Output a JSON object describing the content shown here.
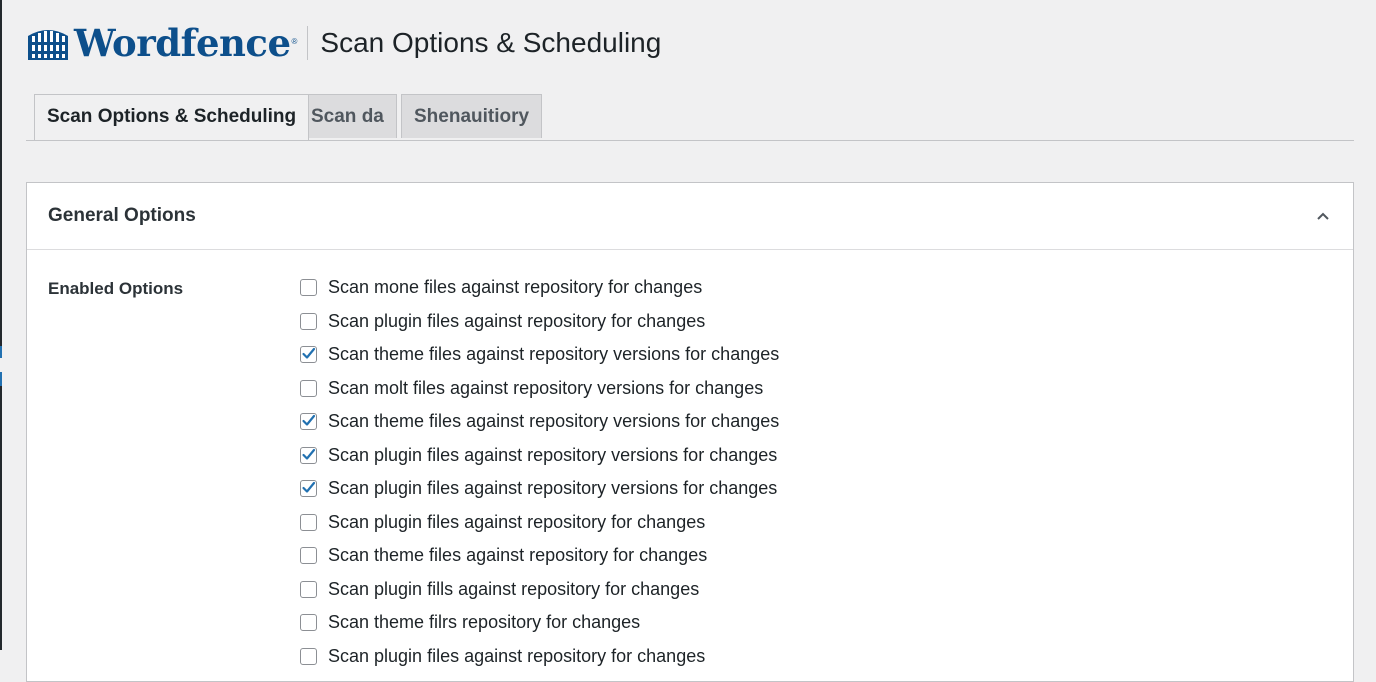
{
  "header": {
    "logo_text": "Wordfence",
    "logo_registered": "®",
    "page_title": "Scan Options & Scheduling"
  },
  "tabs": [
    {
      "label": "Scan Options & Scheduling",
      "active": true
    },
    {
      "label": "Scan da",
      "active": false
    },
    {
      "label": "Shenauitiory",
      "active": false
    }
  ],
  "panel": {
    "title": "General Options",
    "expanded": true,
    "section_label": "Enabled Options",
    "options": [
      {
        "label": "Scan mone files against repository for changes",
        "checked": false
      },
      {
        "label": "Scan plugin files against repository for changes",
        "checked": false
      },
      {
        "label": "Scan theme files against repository versions for changes",
        "checked": true
      },
      {
        "label": "Scan molt files against repository versions for changes",
        "checked": false
      },
      {
        "label": "Scan theme files against repository versions for changes",
        "checked": true
      },
      {
        "label": "Scan plugin files against repository versions for changes",
        "checked": true
      },
      {
        "label": "Scan plugin files against repository versions for changes",
        "checked": true
      },
      {
        "label": "Scan plugin files against repository for changes",
        "checked": false
      },
      {
        "label": "Scan theme files against repository for changes",
        "checked": false
      },
      {
        "label": "Scan plugin fills against repository for changes",
        "checked": false
      },
      {
        "label": "Scan theme filrs repository for changes",
        "checked": false
      },
      {
        "label": "Scan plugin files against repository for changes",
        "checked": false
      }
    ]
  },
  "colors": {
    "brand": "#0d4f8b",
    "checkmark": "#2271b1",
    "page_background": "#f0f0f1",
    "inactive_tab": "#dcdcde"
  }
}
